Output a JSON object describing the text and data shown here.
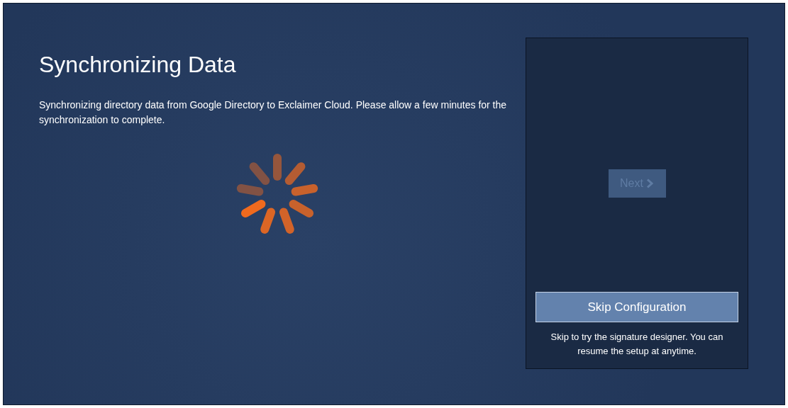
{
  "heading": "Synchronizing Data",
  "description": "Synchronizing directory data from Google Directory to Exclaimer Cloud. Please allow a few minutes for the synchronization to complete.",
  "next_button": {
    "label": "Next",
    "disabled": true
  },
  "skip_button": {
    "label": "Skip Configuration"
  },
  "skip_note": "Skip to try the signature designer. You can resume the setup at anytime."
}
